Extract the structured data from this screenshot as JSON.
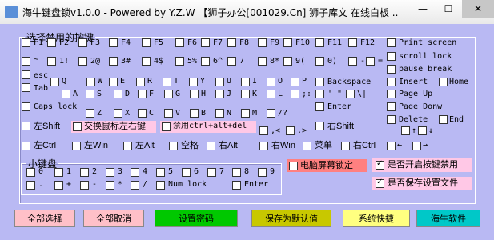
{
  "window": {
    "title": "海牛键盘锁v1.0.0 - Powered by Y.Z.W 【狮子办公[001029.Cn] 狮子库文 在线白板 ...",
    "min": "—",
    "max": "☐",
    "close": "✕"
  },
  "groups": {
    "main_legend": "选择禁用的按键",
    "numpad_legend": "小键盘"
  },
  "keys": {
    "f1": "F1",
    "f2": "F2",
    "f3": "F3",
    "f4": "F4",
    "f5": "F5",
    "f6": "F6",
    "f7": "F7",
    "f8": "F8",
    "f9": "F9",
    "f10": "F10",
    "f11": "F11",
    "f12": "F12",
    "print_screen": "Print screen",
    "scroll_lock": "scroll lock",
    "pause_break": "pause break",
    "tilde": "~",
    "n1": "1!",
    "n2": "2@",
    "n3": "3#",
    "n4": "4$",
    "n5": "5%",
    "n6": "6^",
    "n7": "7",
    "n8": "8*",
    "n9": "9(",
    "n0": "0)",
    "minus": "-",
    "equals": "=",
    "esc": "esc",
    "tab": "Tab",
    "caps": "Caps lock",
    "q": "Q",
    "w": "W",
    "e": "E",
    "r": "R",
    "t": "T",
    "y": "Y",
    "u": "U",
    "i": "I",
    "o": "O",
    "p": "P",
    "backspace": "Backspace",
    "insert": "Insert",
    "home": "Home",
    "a": "A",
    "s": "S",
    "d": "D",
    "f": "F",
    "g": "G",
    "h": "H",
    "j": "J",
    "k": "K",
    "l": "L",
    "semicolon": ";:",
    "quote": "' \"",
    "backslash": "\\|",
    "page_up": "Page Up",
    "enter": "Enter",
    "page_down": "Page Donw",
    "delete": "Delete",
    "end": "End",
    "z": "Z",
    "x": "X",
    "c": "C",
    "v": "V",
    "b": "B",
    "n": "N",
    "m": "M",
    "slash": "/?",
    "lshift": "左Shift",
    "swap_mouse": "交换鼠标左右键",
    "ban_cad": "禁用ctrl+alt+del",
    "comma": ",<",
    "period": ".>",
    "rshift": "右Shift",
    "up": "↑",
    "down": "↓",
    "left": "←",
    "right": "→",
    "lctrl": "左Ctrl",
    "lwin": "左Win",
    "lalt": "左Alt",
    "space": "空格",
    "ralt": "右Alt",
    "rwin": "右Win",
    "menu": "菜单",
    "rctrl": "右Ctrl"
  },
  "numpad": {
    "k0": "0",
    "k1": "1",
    "k2": "2",
    "k3": "3",
    "k4": "4",
    "k5": "5",
    "k6": "6",
    "k7": "7",
    "k8": "8",
    "k9": "9",
    "dot": ".",
    "plus": "+",
    "minus": "-",
    "star": "*",
    "slash": "/",
    "numlock": "Num lock",
    "enter": "Enter"
  },
  "options": {
    "lock_screen": "电脑屏幕锁定",
    "enable_ban": "是否开启按键禁用",
    "save_settings": "是否保存设置文件"
  },
  "buttons": {
    "select_all": "全部选择",
    "cancel_all": "全部取消",
    "set_password": "设置密码",
    "save_default": "保存为默认值",
    "system_shortcut": "系统快捷",
    "hainiu": "海牛软件"
  },
  "colors": {
    "bg": "#b9b9f3",
    "select_all": "#ffc0c8",
    "cancel_all": "#ffc0c8",
    "set_password": "#00c800",
    "save_default": "#c8c800",
    "system_shortcut": "#ffff80",
    "hainiu": "#00c8c8"
  }
}
